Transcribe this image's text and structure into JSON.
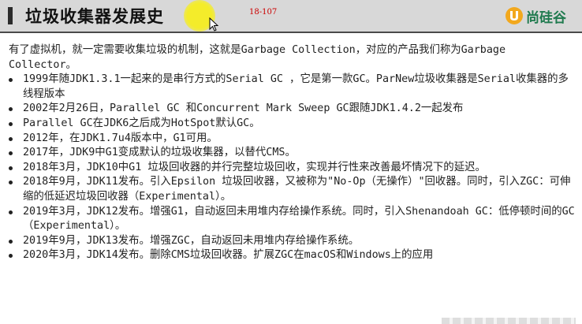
{
  "slide": {
    "title": "垃圾收集器发展史",
    "slide_number": "18-107",
    "brand": "尚硅谷",
    "intro": "有了虚拟机，就一定需要收集垃圾的机制，这就是Garbage Collection，对应的产品我们称为Garbage Collector。",
    "bullets": [
      "1999年随JDK1.3.1一起来的是串行方式的Serial GC ，它是第一款GC。ParNew垃圾收集器是Serial收集器的多线程版本",
      "2002年2月26日，Parallel GC 和Concurrent Mark Sweep GC跟随JDK1.4.2一起发布",
      "Parallel GC在JDK6之后成为HotSpot默认GC。",
      "2012年，在JDK1.7u4版本中，G1可用。",
      "2017年，JDK9中G1变成默认的垃圾收集器，以替代CMS。",
      "2018年3月，JDK10中G1 垃圾回收器的并行完整垃圾回收，实现并行性来改善最坏情况下的延迟。",
      "2018年9月，JDK11发布。引入Epsilon 垃圾回收器，又被称为\"No-Op（无操作）\"回收器。同时，引入ZGC：可伸缩的低延迟垃圾回收器（Experimental）。",
      "2019年3月，JDK12发布。增强G1，自动返回未用堆内存给操作系统。同时，引入Shenandoah GC：低停顿时间的GC（Experimental）。",
      "2019年9月，JDK13发布。增强ZGC，自动返回未用堆内存给操作系统。",
      "2020年3月，JDK14发布。删除CMS垃圾回收器。扩展ZGC在macOS和Windows上的应用"
    ]
  },
  "colors": {
    "title_bar": "#d8d8d8",
    "slide_number": "#cc0000",
    "brand": "#1f7a4e",
    "cursor_highlight": "#f4ec2a"
  },
  "icons": {
    "brand": "atguigu-logo-icon",
    "cursor": "mouse-pointer-icon",
    "bullet": "bullet-dot-icon"
  }
}
